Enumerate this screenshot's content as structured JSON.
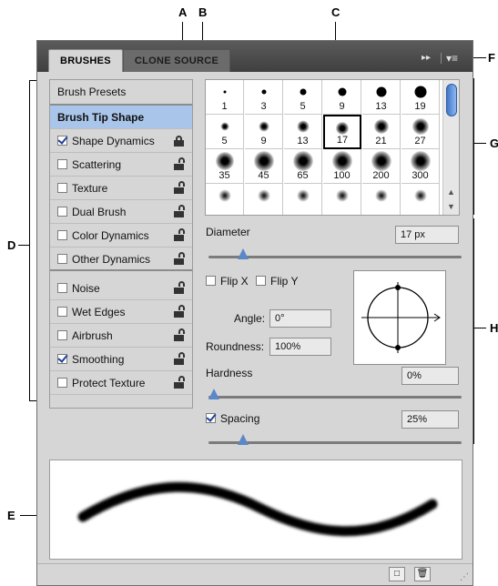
{
  "callouts": {
    "a": "A",
    "b": "B",
    "c": "C",
    "d": "D",
    "e": "E",
    "f": "F",
    "g": "G",
    "h": "H"
  },
  "tabs": {
    "brushes": "BRUSHES",
    "clone_source": "CLONE SOURCE",
    "forward_glyph": "▸▸",
    "menu_glyph": "▾≡"
  },
  "brush_list": {
    "presets": "Brush Presets",
    "tip_shape": "Brush Tip Shape",
    "items": [
      {
        "label": "Shape Dynamics",
        "checked": true,
        "lock": "locked"
      },
      {
        "label": "Scattering",
        "checked": false,
        "lock": "unlocked"
      },
      {
        "label": "Texture",
        "checked": false,
        "lock": "unlocked"
      },
      {
        "label": "Dual Brush",
        "checked": false,
        "lock": "unlocked"
      },
      {
        "label": "Color Dynamics",
        "checked": false,
        "lock": "unlocked"
      },
      {
        "label": "Other Dynamics",
        "checked": false,
        "lock": "unlocked"
      },
      {
        "label": "Noise",
        "checked": false,
        "lock": "unlocked"
      },
      {
        "label": "Wet Edges",
        "checked": false,
        "lock": "unlocked"
      },
      {
        "label": "Airbrush",
        "checked": false,
        "lock": "unlocked"
      },
      {
        "label": "Smoothing",
        "checked": true,
        "lock": "unlocked"
      },
      {
        "label": "Protect Texture",
        "checked": false,
        "lock": "unlocked"
      }
    ]
  },
  "tips": [
    {
      "size": "1",
      "softness": "hard"
    },
    {
      "size": "3",
      "softness": "hard"
    },
    {
      "size": "5",
      "softness": "hard"
    },
    {
      "size": "9",
      "softness": "hard"
    },
    {
      "size": "13",
      "softness": "hard"
    },
    {
      "size": "19",
      "softness": "hard"
    },
    {
      "size": "5",
      "softness": "soft"
    },
    {
      "size": "9",
      "softness": "soft"
    },
    {
      "size": "13",
      "softness": "soft"
    },
    {
      "size": "17",
      "softness": "soft"
    },
    {
      "size": "21",
      "softness": "soft"
    },
    {
      "size": "27",
      "softness": "soft"
    },
    {
      "size": "35",
      "softness": "soft"
    },
    {
      "size": "45",
      "softness": "soft"
    },
    {
      "size": "65",
      "softness": "soft"
    },
    {
      "size": "100",
      "softness": "soft"
    },
    {
      "size": "200",
      "softness": "soft"
    },
    {
      "size": "300",
      "softness": "soft"
    },
    {
      "size": "",
      "softness": "scatter"
    },
    {
      "size": "",
      "softness": "scatter"
    },
    {
      "size": "",
      "softness": "scatter"
    },
    {
      "size": "",
      "softness": "scatter"
    },
    {
      "size": "",
      "softness": "scatter"
    },
    {
      "size": "",
      "softness": "scatter"
    }
  ],
  "selected_tip": "17",
  "controls": {
    "diameter_label": "Diameter",
    "diameter_value": "17 px",
    "diameter_level": 0.12,
    "flip_x": "Flip X",
    "flip_y": "Flip Y",
    "angle_label": "Angle:",
    "angle_value": "0°",
    "roundness_label": "Roundness:",
    "roundness_value": "100%",
    "hardness_label": "Hardness",
    "hardness_value": "0%",
    "hardness_level": 0.0,
    "spacing_label": "Spacing",
    "spacing_value": "25%",
    "spacing_level": 0.12
  },
  "icons": {
    "new_preset": "new-icon",
    "delete": "trash-icon"
  }
}
